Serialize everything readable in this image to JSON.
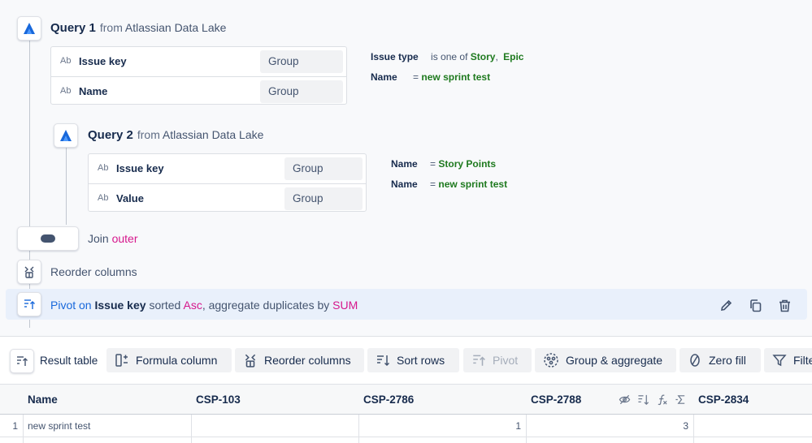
{
  "colors": {
    "accent_blue": "#1868db",
    "highlight_pink": "#d6178c",
    "filter_green": "#1f7a1f",
    "selected_step_bg": "#e9f0fb"
  },
  "query1": {
    "title": "Query 1",
    "from": "from",
    "source": "Atlassian Data Lake",
    "fields": [
      {
        "type": "Ab",
        "name": "Issue key",
        "agg": "Group"
      },
      {
        "type": "Ab",
        "name": "Name",
        "agg": "Group"
      }
    ],
    "filters": {
      "f1": {
        "field": "Issue type",
        "op": "is one of",
        "v1": "Story",
        "sep": ",",
        "v2": "Epic"
      },
      "f2": {
        "field": "Name",
        "op": "=",
        "value": "new sprint test"
      }
    }
  },
  "query2": {
    "title": "Query 2",
    "from": "from",
    "source": "Atlassian Data Lake",
    "fields": [
      {
        "type": "Ab",
        "name": "Issue key",
        "agg": "Group"
      },
      {
        "type": "Ab",
        "name": "Value",
        "agg": "Group"
      }
    ],
    "filters": {
      "f1": {
        "field": "Name",
        "op": "=",
        "value": "Story Points"
      },
      "f2": {
        "field": "Name",
        "op": "=",
        "value": "new sprint test"
      }
    }
  },
  "steps": {
    "join": {
      "label": "Join",
      "type": "outer"
    },
    "reorder": {
      "label": "Reorder columns"
    },
    "pivot": {
      "label": "Pivot on",
      "key": "Issue key",
      "sorted": "sorted",
      "order": "Asc",
      "agg_text": ", aggregate duplicates by",
      "agg": "SUM"
    }
  },
  "toolbar": {
    "result": "Result table",
    "formula": "Formula column",
    "reorder": "Reorder columns",
    "sort": "Sort rows",
    "pivot": "Pivot",
    "group": "Group & aggregate",
    "zero": "Zero fill",
    "filter": "Filter"
  },
  "table": {
    "columns": [
      "Name",
      "CSP-103",
      "CSP-2786",
      "CSP-2788",
      "CSP-2834"
    ],
    "rows": [
      {
        "num": "1",
        "cells": [
          "new sprint test",
          "",
          "1",
          "3",
          ""
        ]
      }
    ]
  }
}
